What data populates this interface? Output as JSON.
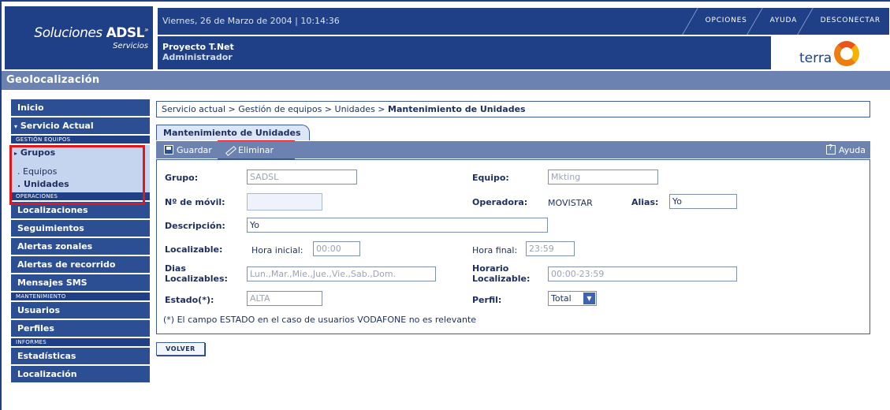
{
  "header": {
    "brand_main": "Soluciones",
    "brand_bold": "ADSL",
    "brand_sup": "»",
    "brand_sub": "Servicios",
    "datetime": "Viernes, 26 de Marzo de 2004 | 10:14:36",
    "menu": [
      "OPCIONES",
      "AYUDA",
      "DESCONECTAR"
    ],
    "project": "Proyecto T.Net",
    "role": "Administrador",
    "partner_logo": "terra"
  },
  "section_title": "Geolocalización",
  "sidebar": {
    "inicio": "Inicio",
    "servicio_actual": "Servicio Actual",
    "gestion_equipos": "GESTIÓN EQUIPOS",
    "grupos": "Grupos",
    "equipos": ". Equipos",
    "unidades": ". Unidades",
    "operaciones": "OPERACIONES",
    "localizaciones": "Localizaciones",
    "seguimientos": "Seguimientos",
    "alertas_zonales": "Alertas zonales",
    "alertas_recorrido": "Alertas de recorrido",
    "mensajes_sms": "Mensajes SMS",
    "mantenimiento": "MANTENIMIENTO",
    "usuarios": "Usuarios",
    "perfiles": "Perfiles",
    "informes": "INFORMES",
    "estadisticas": "Estadísticas",
    "localizacion": "Localización"
  },
  "breadcrumb": {
    "path": "Servicio actual > Gestión de equipos > Unidades > ",
    "current": "Mantenimiento de Unidades"
  },
  "tab_label": "Mantenimiento de Unidades",
  "toolbar": {
    "save": "Guardar",
    "delete": "Eliminar",
    "help": "Ayuda"
  },
  "form": {
    "grupo_label": "Grupo:",
    "grupo_value": "SADSL",
    "equipo_label": "Equipo:",
    "equipo_value": "Mkting",
    "movil_label": "Nº de móvil:",
    "movil_value": "",
    "operadora_label": "Operadora:",
    "operadora_value": "MOVISTAR",
    "alias_label": "Alias:",
    "alias_value": "Yo",
    "descripcion_label": "Descripción:",
    "descripcion_value": "Yo",
    "localizable_label": "Localizable:",
    "hora_inicial_label": "Hora inicial:",
    "hora_inicial_value": "00:00",
    "hora_final_label": "Hora final:",
    "hora_final_value": "23:59",
    "dias_label_1": "Dias",
    "dias_label_2": "Localizables:",
    "dias_value": "Lun.,Mar.,Mie.,Jue.,Vie.,Sab.,Dom.",
    "horario_label_1": "Horario",
    "horario_label_2": "Localizable:",
    "horario_value": "00:00-23:59",
    "estado_label": "Estado(*):",
    "estado_value": "ALTA",
    "perfil_label": "Perfil:",
    "perfil_value": "Total",
    "note": "(*) El campo ESTADO en el caso de usuarios VODAFONE no es relevante"
  },
  "volver_label": "VOLVER"
}
